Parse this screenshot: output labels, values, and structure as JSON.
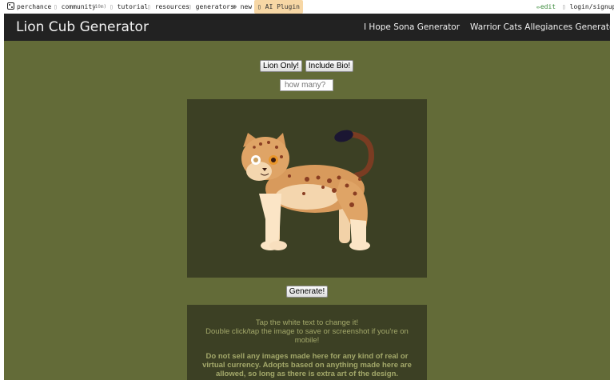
{
  "topbar": {
    "brand": "perchance",
    "community": "community",
    "community_count": "(10m)",
    "tutorial": "tutorial",
    "resources": "resources",
    "generators": "generators",
    "new": "new",
    "ai_plugin": "AI Plugin",
    "edit": "edit",
    "login": "login/signup"
  },
  "header": {
    "title": "Lion Cub Generator",
    "nav": [
      "I Hope Sona Generator",
      "Warrior Cats Allegiances Generator"
    ]
  },
  "controls": {
    "lion_only": "Lion Only!",
    "include_bio": "Include Bio!",
    "count_placeholder": "how many?",
    "generate": "Generate!"
  },
  "info": {
    "line1": "Tap the white text to change it!",
    "line2": "Double click/tap the image to save or screenshot if you're on mobile!",
    "notice": "Do not sell any images made here for any kind of real or virtual currency. Adopts based on anything made here are allowed, so long as there is extra art of the design."
  },
  "colors": {
    "page_bg": "#636b38",
    "panel_bg": "#3c4024",
    "header_bg": "#222222",
    "info_text": "#a3a86a"
  }
}
